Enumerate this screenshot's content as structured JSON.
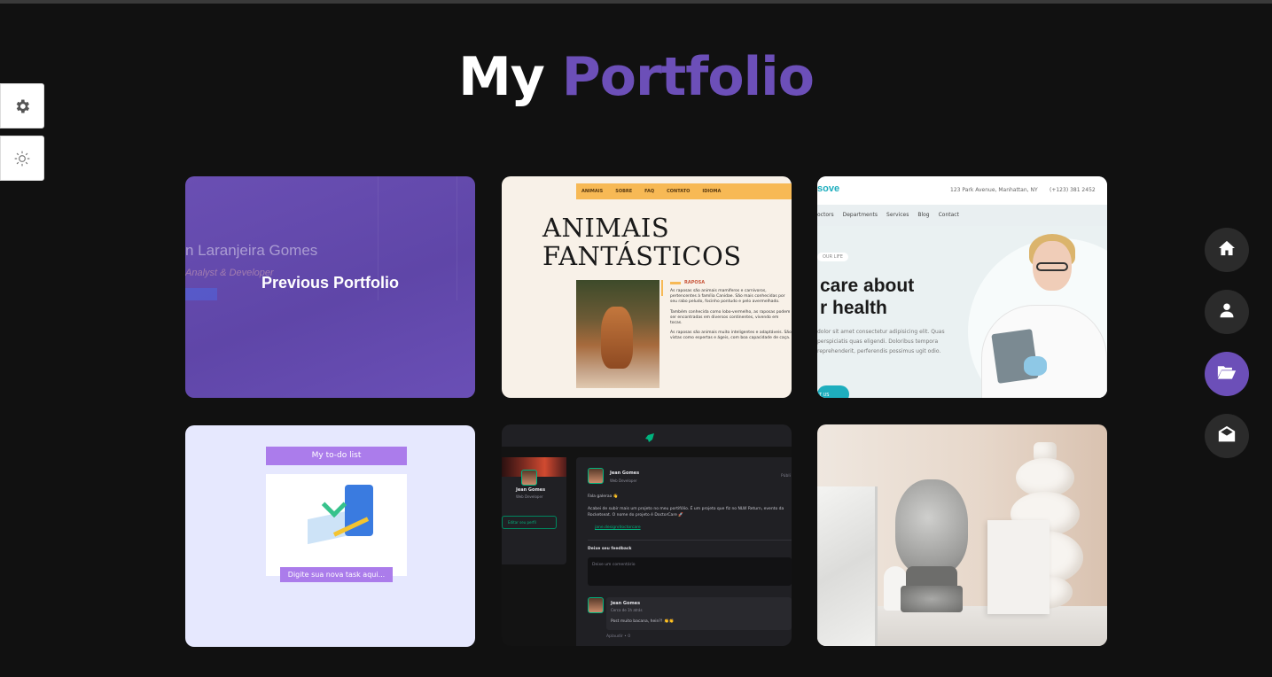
{
  "page": {
    "title_word1": "My",
    "title_word2": "Portfolio",
    "colors": {
      "background": "#111111",
      "accent": "#6c4fb8"
    }
  },
  "side_buttons": [
    {
      "icon": "gear-icon"
    },
    {
      "icon": "sun-icon"
    }
  ],
  "nav": [
    {
      "icon": "home-icon",
      "active": false
    },
    {
      "icon": "user-icon",
      "active": false
    },
    {
      "icon": "folder-open-icon",
      "active": true
    },
    {
      "icon": "envelope-open-icon",
      "active": false
    }
  ],
  "cards": {
    "previous": {
      "label": "Previous Portfolio",
      "ghost_name": "n Laranjeira Gomes",
      "ghost_role": "Analyst & Developer"
    },
    "animais": {
      "nav_items": [
        "ANIMAIS",
        "SOBRE",
        "FAQ",
        "CONTATO",
        "IDIOMA"
      ],
      "heading_line1": "ANIMAIS",
      "heading_line2": "FANTÁSTICOS",
      "subheading": "RAPOSA",
      "para1": "As raposas são animais mamíferos e carnívoros, pertencentes à família Canidae. São mais conhecidas por seu rabo peludo, focinho pontudo e pelo avermelhado.",
      "para2": "Também conhecida como lobo-vermelho, as raposas podem ser encontradas em diversos continentes, vivendo em tocas.",
      "para3": "As raposas são animais muito inteligentes e adaptáveis. São vistas como espertas e ágeis, com boa capacidade de caça."
    },
    "medical": {
      "logo": "sove",
      "address": "123 Park Avenue, Manhattan, NY",
      "phone": "(+123) 381 2452",
      "menu": [
        "octors",
        "Departments",
        "Services",
        "Blog",
        "Contact"
      ],
      "pill": "OUR LIFE",
      "headline_line1": "care about",
      "headline_line2": "r health",
      "text": "dolor sit amet consectetur adipisicing elit. Quas perspiciatis quas eligendi. Doloribus tempora reprehenderit, perferendis possimus ugit odio.",
      "button": "T US"
    },
    "todo": {
      "title": "My to-do list",
      "input_placeholder": "Digite sua nova task aqui..."
    },
    "feed": {
      "profile_name": "Jean Gomes",
      "profile_role": "Web Developer",
      "edit_button": "Editar seu perfil",
      "post_author": "Jean Gomes",
      "post_role": "Web Developer",
      "post_time": "Públi",
      "post_greeting": "Fala galeraa 👋",
      "post_body": "Acabei de subir mais um projeto no meu portifólio. É um projeto que fiz no NLW Return, evento da Rocketseat. O nome do projeto é DoctorCare 🚀",
      "post_link": "jane.design/doctorcare",
      "feedback_label": "Deixe seu feedback",
      "textarea_placeholder": "Deixe um comentário",
      "comment_author": "Jean Gomes",
      "comment_time": "Cerca de 1h atrás",
      "comment_text": "Post muito bacana, hein?! 👏👏",
      "applause": "Aplaudir • 0"
    },
    "buddha": {}
  }
}
